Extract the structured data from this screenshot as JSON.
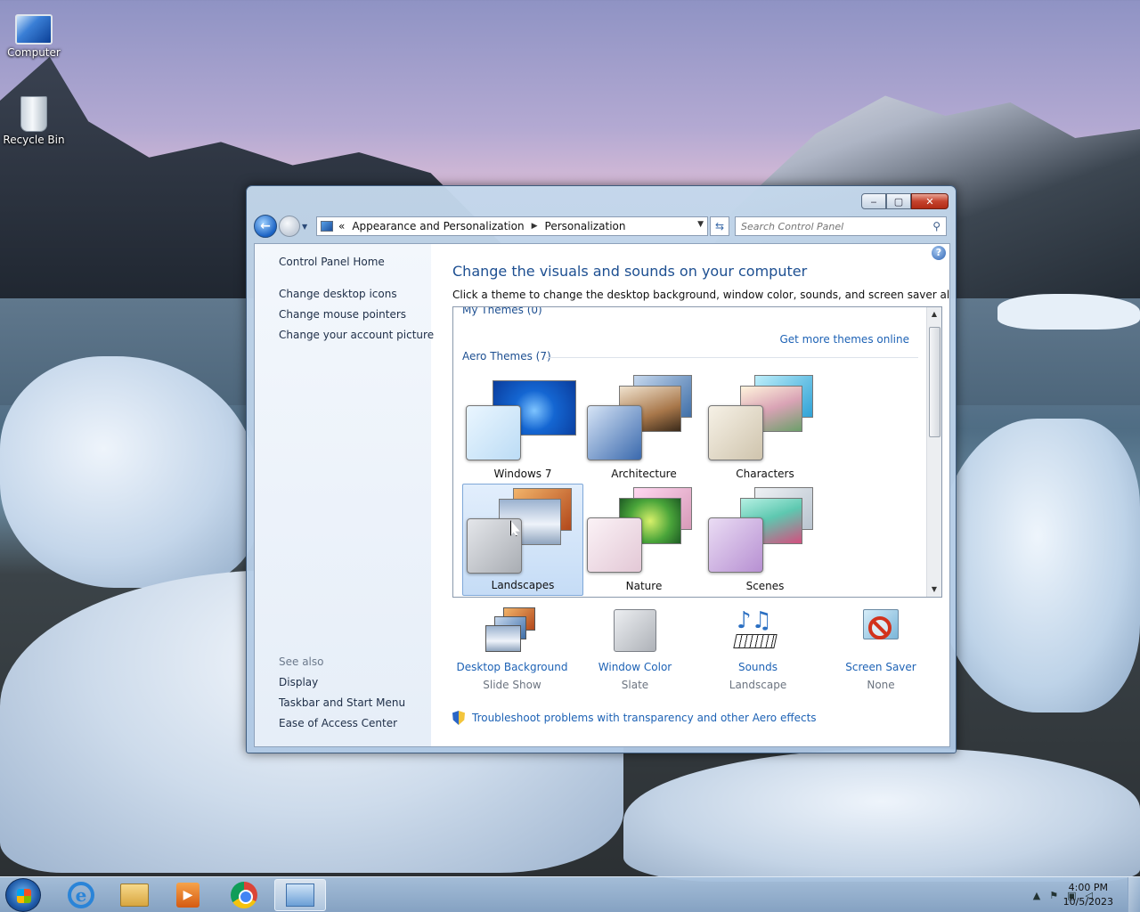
{
  "desktop": {
    "icons": [
      {
        "label": "Computer"
      },
      {
        "label": "Recycle Bin"
      }
    ]
  },
  "window": {
    "controls": {
      "minimize": "‒",
      "maximize": "▢",
      "close": "✕"
    },
    "address": {
      "prefix": "«",
      "crumbs": [
        "Appearance and Personalization",
        "Personalization"
      ]
    },
    "search": {
      "placeholder": "Search Control Panel"
    }
  },
  "sidebar": {
    "home": "Control Panel Home",
    "tasks": [
      "Change desktop icons",
      "Change mouse pointers",
      "Change your account picture"
    ],
    "see_also_heading": "See also",
    "see_also": [
      "Display",
      "Taskbar and Start Menu",
      "Ease of Access Center"
    ]
  },
  "main": {
    "title": "Change the visuals and sounds on your computer",
    "description": "Click a theme to change the desktop background, window color, sounds, and screen saver all at once.",
    "my_themes_label": "My Themes (0)",
    "get_more_link": "Get more themes online",
    "aero_label": "Aero Themes (7)",
    "themes": [
      {
        "name": "Windows 7",
        "selected": false
      },
      {
        "name": "Architecture",
        "selected": false
      },
      {
        "name": "Characters",
        "selected": false
      },
      {
        "name": "Landscapes",
        "selected": true
      },
      {
        "name": "Nature",
        "selected": false
      },
      {
        "name": "Scenes",
        "selected": false
      }
    ],
    "settings": [
      {
        "name": "Desktop Background",
        "value": "Slide Show"
      },
      {
        "name": "Window Color",
        "value": "Slate"
      },
      {
        "name": "Sounds",
        "value": "Landscape"
      },
      {
        "name": "Screen Saver",
        "value": "None"
      }
    ],
    "troubleshoot_link": "Troubleshoot problems with transparency and other Aero effects"
  },
  "taskbar": {
    "clock_time": "4:00 PM",
    "clock_date": "10/5/2023"
  }
}
